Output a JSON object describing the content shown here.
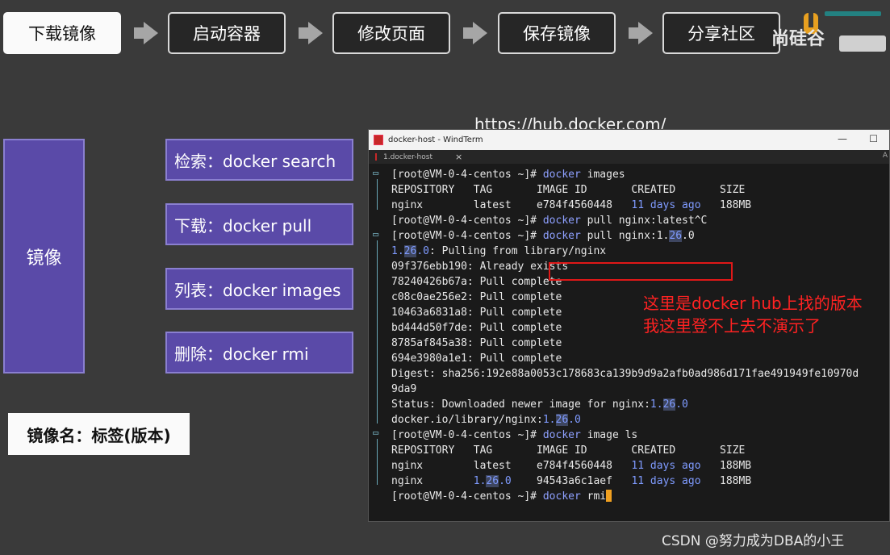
{
  "flow": {
    "steps": [
      "下载镜像",
      "启动容器",
      "修改页面",
      "保存镜像",
      "分享社区"
    ]
  },
  "watermark": {
    "top_text": "尚硅谷"
  },
  "url_text": "https://hub.docker.com/",
  "concept": {
    "main_label": "镜像",
    "commands": [
      "检索：docker search",
      "下载：docker pull",
      "列表：docker images",
      "删除：docker rmi"
    ],
    "tag_format": "镜像名：标签(版本)"
  },
  "terminal": {
    "window_title": "docker-host - WindTerm",
    "tab_label": "1.docker-host",
    "tab_right_label": "A",
    "lines": [
      "[root@VM-0-4-centos ~]# docker images",
      "REPOSITORY   TAG       IMAGE ID       CREATED       SIZE",
      "nginx        latest    e784f4560448   11 days ago   188MB",
      "[root@VM-0-4-centos ~]# docker pull nginx:latest^C",
      "[root@VM-0-4-centos ~]# docker pull nginx:1.26.0",
      "1.26.0: Pulling from library/nginx",
      "09f376ebb190: Already exists",
      "78240426b67a: Pull complete",
      "c08c0ae256e2: Pull complete",
      "10463a6831a8: Pull complete",
      "bd444d50f7de: Pull complete",
      "8785af845a38: Pull complete",
      "694e3980a1e1: Pull complete",
      "Digest: sha256:192e88a0053c178683ca139b9d9a2afb0ad986d171fae491949fe10970d",
      "9da9",
      "Status: Downloaded newer image for nginx:1.26.0",
      "docker.io/library/nginx:1.26.0",
      "[root@VM-0-4-centos ~]# docker image ls",
      "REPOSITORY   TAG       IMAGE ID       CREATED       SIZE",
      "nginx        latest    e784f4560448   11 days ago   188MB",
      "nginx        1.26.0    94543a6c1aef   11 days ago   188MB",
      "[root@VM-0-4-centos ~]# docker rmi"
    ]
  },
  "annotation": "这里是docker hub上找的版本我这里登不上去不演示了",
  "footer_watermark": "CSDN @努力成为DBA的小王",
  "colors": {
    "accent_purple": "#5a4aa8",
    "annotation_red": "#ff2222",
    "terminal_bg": "#1a1a1a",
    "cursor": "#f0a020"
  }
}
